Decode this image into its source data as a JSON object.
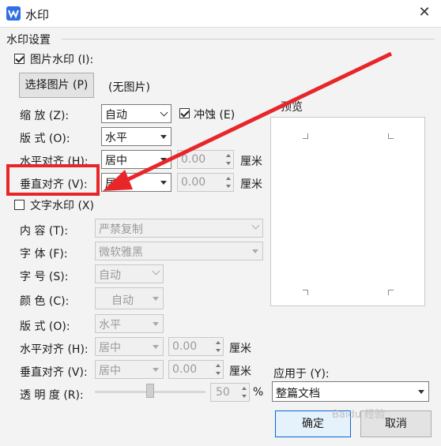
{
  "window": {
    "title": "水印"
  },
  "group": {
    "title": "水印设置"
  },
  "picture": {
    "checkbox_label": "图片水印 (I):",
    "select_button": "选择图片 (P)",
    "status": "(无图片)",
    "scale_label": "缩  放 (Z):",
    "scale_value": "自动",
    "washout_label": "冲蚀 (E)",
    "layout_label": "版  式 (O):",
    "layout_value": "水平",
    "halign_label": "水平对齐 (H):",
    "halign_value": "居中",
    "halign_offset": "0.00",
    "valign_label": "垂直对齐 (V):",
    "valign_value": "居中",
    "valign_offset": "0.00",
    "unit": "厘米"
  },
  "text": {
    "checkbox_label": "文字水印 (X)",
    "content_label": "内  容 (T):",
    "content_value": "严禁复制",
    "font_label": "字  体 (F):",
    "font_value": "微软雅黑",
    "size_label": "字  号 (S):",
    "size_value": "自动",
    "color_label": "颜  色 (C):",
    "color_value": "自动",
    "layout_label": "版  式 (O):",
    "layout_value": "水平",
    "halign_label": "水平对齐 (H):",
    "halign_value": "居中",
    "halign_offset": "0.00",
    "valign_label": "垂直对齐 (V):",
    "valign_value": "居中",
    "valign_offset": "0.00",
    "unit": "厘米",
    "transparency_label": "透 明 度 (R):",
    "transparency_value": "50",
    "transparency_unit": "%"
  },
  "preview": {
    "label": "预览"
  },
  "apply": {
    "label": "应用于 (Y):",
    "value": "整篇文档"
  },
  "buttons": {
    "ok": "确定",
    "cancel": "取消"
  },
  "watermark_text": "Baidu 经验",
  "colors": {
    "accent": "#2f6fe6",
    "annotation": "#e8262a"
  },
  "transparency_percent": 50
}
